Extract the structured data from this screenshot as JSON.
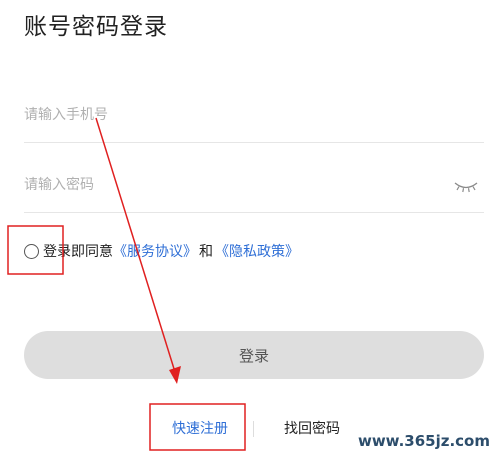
{
  "header": {
    "title": "账号密码登录"
  },
  "form": {
    "phone_placeholder": "请输入手机号",
    "password_placeholder": "请输入密码",
    "password_visibility_icon": "eye-closed-icon"
  },
  "agreement": {
    "checked": false,
    "prefix": "登录即同意",
    "terms_link": "《服务协议》",
    "conjunction": "和",
    "privacy_link": "《隐私政策》"
  },
  "actions": {
    "login_label": "登录",
    "register_label": "快速注册",
    "forgot_label": "找回密码"
  },
  "watermark": {
    "text": "www.365jz.com"
  },
  "colors": {
    "link": "#2f6fd6",
    "annotation": "#e02020",
    "button_bg": "#dedede"
  }
}
